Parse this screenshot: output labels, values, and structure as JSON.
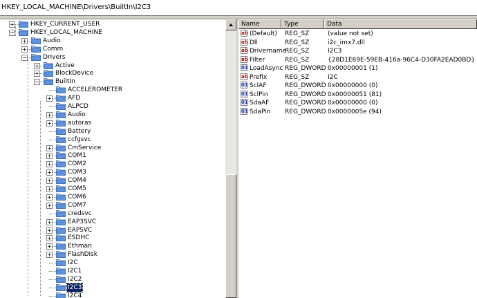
{
  "path": "HKEY_LOCAL_MACHINE\\Drivers\\BuiltIn\\I2C3",
  "tree": {
    "nodes": [
      {
        "label": "HKEY_CURRENT_USER",
        "expander": "+"
      },
      {
        "label": "HKEY_LOCAL_MACHINE",
        "expander": "-"
      },
      {
        "label": "Audio",
        "expander": "+"
      },
      {
        "label": "Comm",
        "expander": "+"
      },
      {
        "label": "Drivers",
        "expander": "-"
      },
      {
        "label": "Active",
        "expander": "+"
      },
      {
        "label": "BlockDevice",
        "expander": "+"
      },
      {
        "label": "BuiltIn",
        "expander": "-"
      },
      {
        "label": "ACCELEROMETER",
        "expander": ""
      },
      {
        "label": "AFD",
        "expander": "+"
      },
      {
        "label": "ALPCD",
        "expander": ""
      },
      {
        "label": "Audio",
        "expander": "+"
      },
      {
        "label": "autoras",
        "expander": "+"
      },
      {
        "label": "Battery",
        "expander": ""
      },
      {
        "label": "ccfgsvc",
        "expander": ""
      },
      {
        "label": "CmService",
        "expander": "+"
      },
      {
        "label": "COM1",
        "expander": "+"
      },
      {
        "label": "COM2",
        "expander": "+"
      },
      {
        "label": "COM3",
        "expander": "+"
      },
      {
        "label": "COM4",
        "expander": "+"
      },
      {
        "label": "COM5",
        "expander": "+"
      },
      {
        "label": "COM6",
        "expander": "+"
      },
      {
        "label": "COM7",
        "expander": "+"
      },
      {
        "label": "credsvc",
        "expander": ""
      },
      {
        "label": "EAP3SVC",
        "expander": "+"
      },
      {
        "label": "EAPSVC",
        "expander": "+"
      },
      {
        "label": "ESDHC",
        "expander": "+"
      },
      {
        "label": "Ethman",
        "expander": "+"
      },
      {
        "label": "FlashDisk",
        "expander": "+"
      },
      {
        "label": "I2C",
        "expander": ""
      },
      {
        "label": "I2C1",
        "expander": ""
      },
      {
        "label": "I2C2",
        "expander": ""
      },
      {
        "label": "I2C3",
        "expander": "",
        "selected": true
      },
      {
        "label": "I2C4",
        "expander": ""
      }
    ]
  },
  "list": {
    "columns": [
      "Name",
      "Type",
      "Data"
    ],
    "rows": [
      {
        "name": "(Default)",
        "type": "REG_SZ",
        "data": "(value not set)",
        "icon": "string-value-icon"
      },
      {
        "name": "Dll",
        "type": "REG_SZ",
        "data": "i2c_imx7.dll",
        "icon": "string-value-icon"
      },
      {
        "name": "Drivername",
        "type": "REG_SZ",
        "data": "I2C3",
        "icon": "string-value-icon"
      },
      {
        "name": "Filter",
        "type": "REG_SZ",
        "data": "{28D1E69E-59EB-416a-96C4-D30FA2EAD0BD}",
        "icon": "string-value-icon"
      },
      {
        "name": "LoadAsync",
        "type": "REG_DWORD",
        "data": "0x00000001 (1)",
        "icon": "dword-value-icon"
      },
      {
        "name": "Prefix",
        "type": "REG_SZ",
        "data": "I2C",
        "icon": "string-value-icon"
      },
      {
        "name": "SclAF",
        "type": "REG_DWORD",
        "data": "0x00000000 (0)",
        "icon": "dword-value-icon"
      },
      {
        "name": "SclPin",
        "type": "REG_DWORD",
        "data": "0x00000051 (81)",
        "icon": "dword-value-icon"
      },
      {
        "name": "SdaAF",
        "type": "REG_DWORD",
        "data": "0x00000000 (0)",
        "icon": "dword-value-icon"
      },
      {
        "name": "SdaPin",
        "type": "REG_DWORD",
        "data": "0x0000005e (94)",
        "icon": "dword-value-icon"
      }
    ]
  },
  "colors": {
    "selection": "#0a246a",
    "folder": "#3a7bd5",
    "chrome": "#d4d0c8"
  }
}
